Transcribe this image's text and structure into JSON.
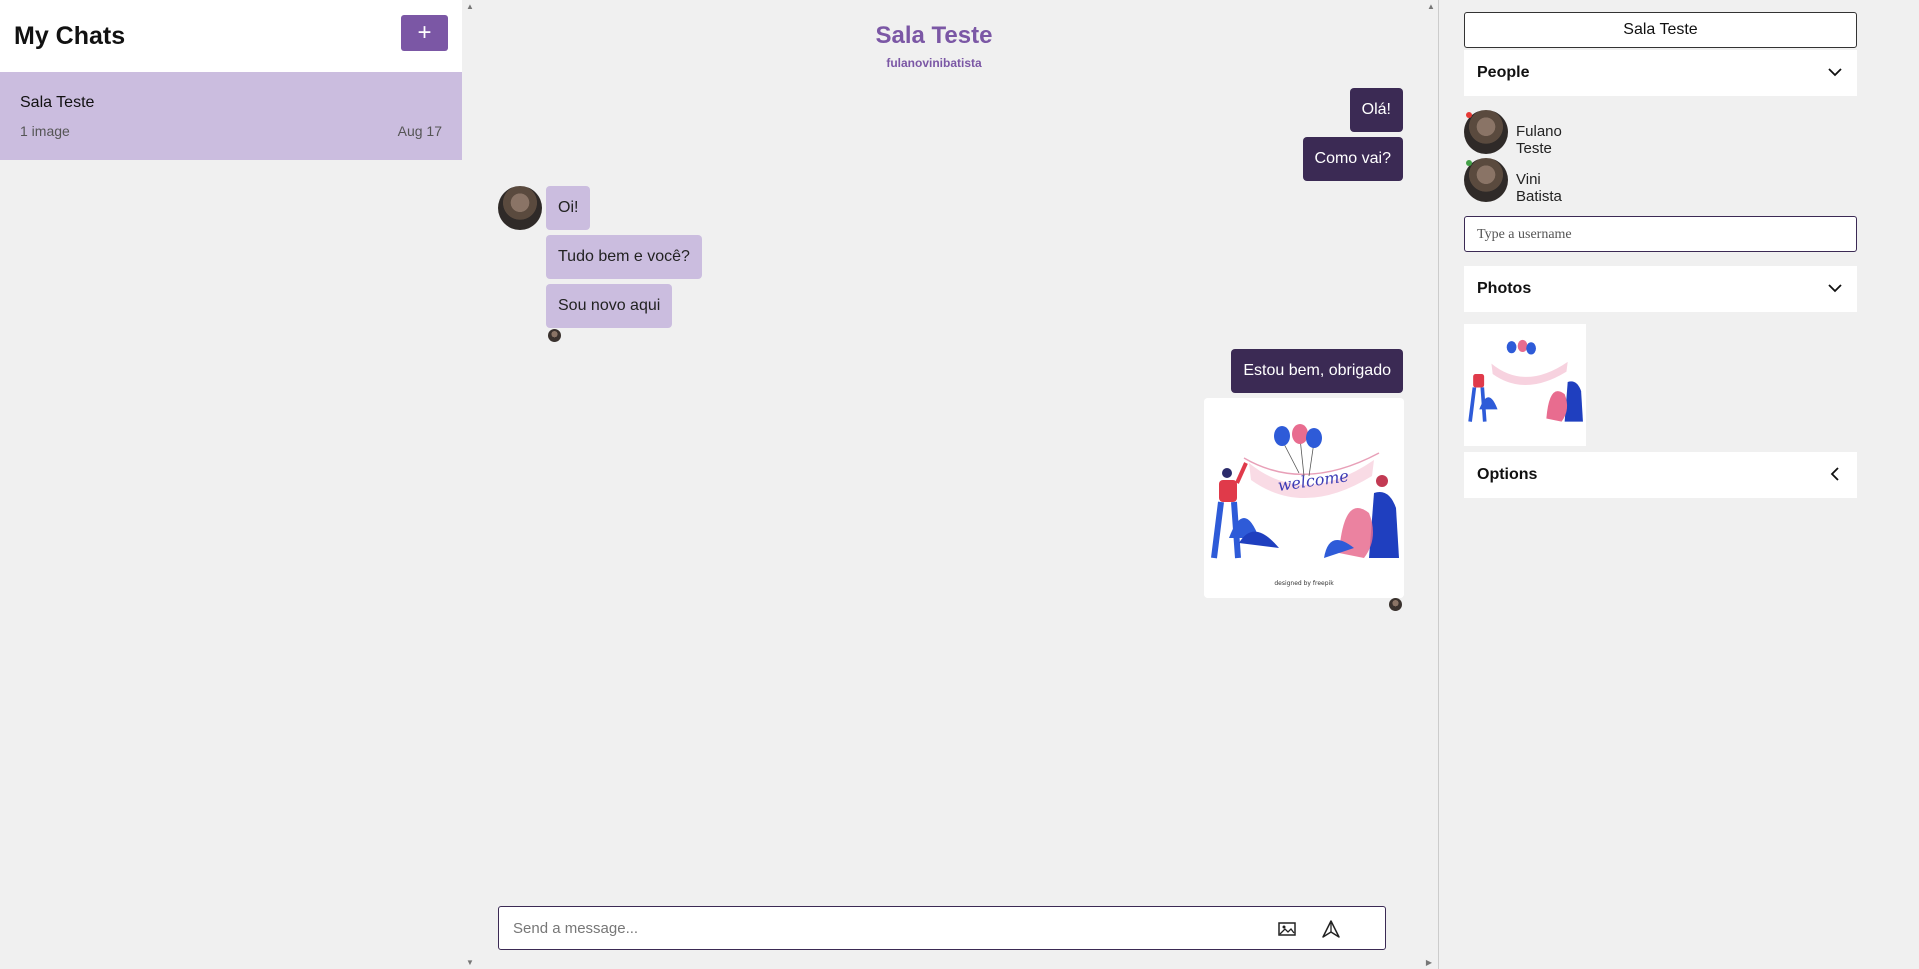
{
  "sidebar": {
    "title": "My Chats",
    "new_chat_label": "+",
    "chats": [
      {
        "title": "Sala Teste",
        "subtitle": "1 image",
        "date": "Aug 17"
      }
    ]
  },
  "feed": {
    "title": "Sala Teste",
    "subtitle": "fulanovinibatista",
    "messages": [
      {
        "text": "Olá!",
        "mine": true
      },
      {
        "text": "Como vai?",
        "mine": true
      },
      {
        "text": "Oi!",
        "mine": false
      },
      {
        "text": "Tudo bem e você?",
        "mine": false
      },
      {
        "text": "Sou novo aqui",
        "mine": false
      },
      {
        "text": "Estou bem, obrigado",
        "mine": true
      }
    ],
    "image_caption": "designed by freepik",
    "image_word": "welcome"
  },
  "composer": {
    "placeholder": "Send a message..."
  },
  "settings": {
    "room_name": "Sala Teste",
    "people_label": "People",
    "people": [
      {
        "name": "Fulano Teste",
        "status_color": "#e53935"
      },
      {
        "name": "Vini Batista",
        "status_color": "#43a047"
      }
    ],
    "username_placeholder": "Type a username",
    "photos_label": "Photos",
    "options_label": "Options"
  },
  "colors": {
    "accent": "#7b57a5",
    "my_bubble": "#3b2a54",
    "their_bubble": "#cbbddf"
  }
}
